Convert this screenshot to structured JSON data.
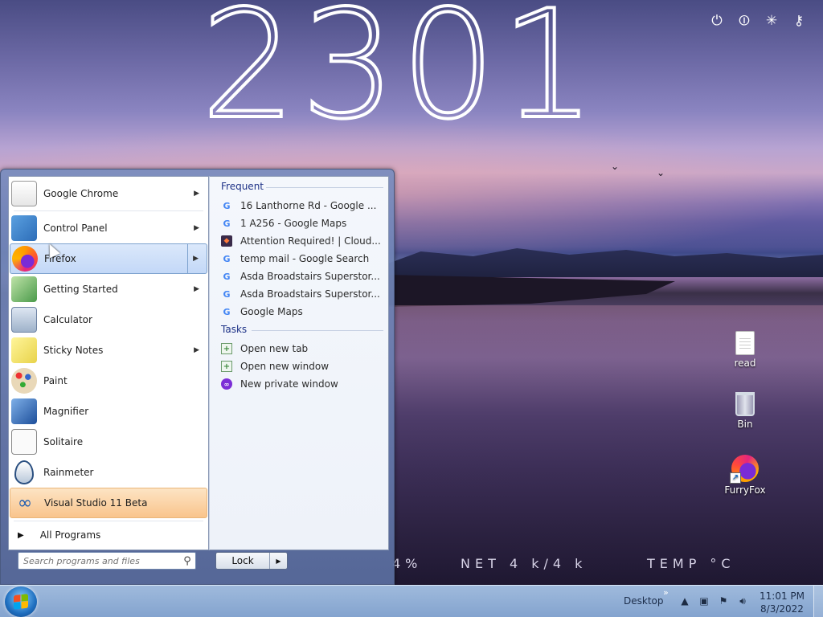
{
  "wallpaper": {
    "accent": "#5b5a9c"
  },
  "clock": {
    "digits": "2301"
  },
  "top_icons": [
    {
      "name": "power-icon",
      "glyph": "⏻"
    },
    {
      "name": "restart-icon",
      "glyph": "⏼"
    },
    {
      "name": "sleep-icon",
      "glyph": "✳"
    },
    {
      "name": "key-icon",
      "glyph": "⚷"
    }
  ],
  "stats": {
    "cpu": "4%",
    "net": "NET 4 k/4 k",
    "temp": "TEMP °C"
  },
  "desktop_icons": [
    {
      "label": "read"
    },
    {
      "label": "Bin"
    },
    {
      "label": "FurryFox"
    }
  ],
  "start_menu": {
    "programs": [
      {
        "label": "Google Chrome",
        "has_submenu": true
      },
      {
        "label": "Control Panel",
        "has_submenu": true
      },
      {
        "label": "Firefox",
        "has_submenu": true
      },
      {
        "label": "Getting Started",
        "has_submenu": true
      },
      {
        "label": "Calculator",
        "has_submenu": false
      },
      {
        "label": "Sticky Notes",
        "has_submenu": true
      },
      {
        "label": "Paint",
        "has_submenu": false
      },
      {
        "label": "Magnifier",
        "has_submenu": false
      },
      {
        "label": "Solitaire",
        "has_submenu": false
      },
      {
        "label": "Rainmeter",
        "has_submenu": false
      },
      {
        "label": "Visual Studio 11 Beta",
        "has_submenu": false
      }
    ],
    "all_programs": "All Programs",
    "frequent_title": "Frequent",
    "frequent": [
      {
        "label": "16 Lanthorne Rd - Google ...",
        "icon": "google-icon"
      },
      {
        "label": "1 A256 - Google Maps",
        "icon": "google-icon"
      },
      {
        "label": "Attention Required! | Cloud...",
        "icon": "cloudflare-icon"
      },
      {
        "label": "temp mail - Google Search",
        "icon": "google-icon"
      },
      {
        "label": "Asda Broadstairs Superstor...",
        "icon": "google-icon"
      },
      {
        "label": "Asda Broadstairs Superstor...",
        "icon": "google-icon"
      },
      {
        "label": "Google Maps",
        "icon": "google-icon"
      }
    ],
    "tasks_title": "Tasks",
    "tasks": [
      {
        "label": "Open new tab",
        "icon": "new-tab-icon"
      },
      {
        "label": "Open new window",
        "icon": "new-window-icon"
      },
      {
        "label": "New private window",
        "icon": "private-window-icon"
      }
    ],
    "search_placeholder": "Search programs and files",
    "lock_label": "Lock"
  },
  "taskbar": {
    "desktop_label": "Desktop",
    "time": "11:01 PM",
    "date": "8/3/2022"
  }
}
